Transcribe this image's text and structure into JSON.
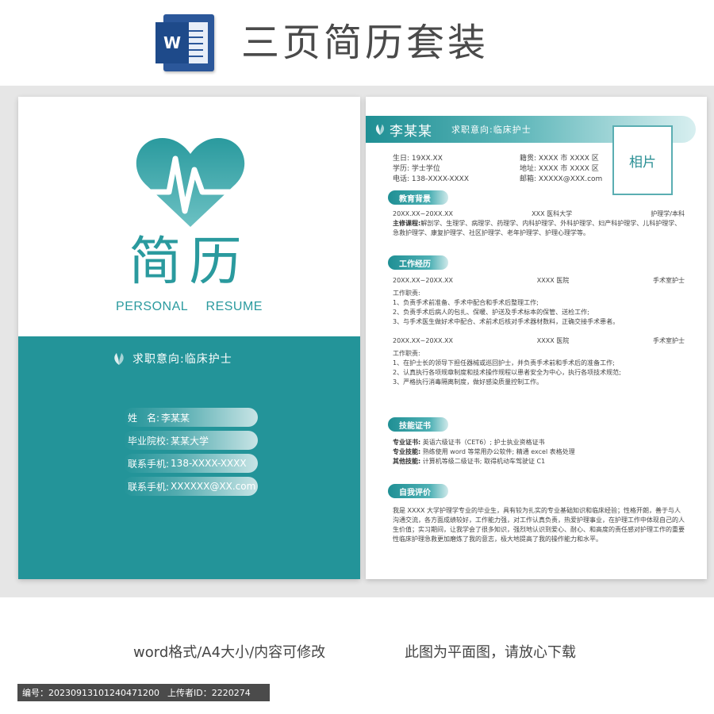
{
  "header": {
    "app_icon": "word-icon",
    "app_icon_letter": "W",
    "title": "三页简历套装"
  },
  "colors": {
    "accent": "#239499",
    "accent_light": "#5db6b9",
    "header_text": "#4a4a4a",
    "word_blue": "#2b579a"
  },
  "cover": {
    "logo": "heart-ecg-icon",
    "title": "简历",
    "subtitle": "PERSONAL RESUME",
    "intent_icon": "leaf-icon",
    "intent": "求职意向:临床护士",
    "info": [
      {
        "label": "姓　名:",
        "value": "李某某"
      },
      {
        "label": "毕业院校:",
        "value": "某某大学"
      },
      {
        "label": "联系手机:",
        "value": "138-XXXX-XXXX"
      },
      {
        "label": "联系手机:",
        "value": "XXXXXX@XX.com"
      }
    ]
  },
  "resume": {
    "name": "李某某",
    "intent": "求职意向:临床护士",
    "photo_label": "相片",
    "basic": [
      {
        "left": "生日: 19XX.XX",
        "right": "籍贯: XXXX 市 XXXX 区"
      },
      {
        "left": "学历: 学士学位",
        "right": "地址: XXXX 市 XXXX 区"
      },
      {
        "left": "电话: 138-XXXX-XXXX",
        "right": "邮箱: XXXXX@XXX.com"
      }
    ],
    "education": {
      "title": "教育背景",
      "period": "20XX.XX~20XX.XX",
      "school": "XXX 医科大学",
      "degree": "护理学/本科",
      "courses_label": "主修课程:",
      "courses": "解剖学、生理学、病理学、药理学、内科护理学、外科护理学、妇产科护理学、儿科护理学、急救护理学、康复护理学、社区护理学、老年护理学、护理心理学等。"
    },
    "work": {
      "title": "工作经历",
      "jobs": [
        {
          "period": "20XX.XX~20XX.XX",
          "org": "XXXX 医院",
          "role": "手术室护士",
          "duties_label": "工作职责:",
          "duties": [
            "1、负责手术前准备、手术中配合和手术后整理工作;",
            "2、负责手术后病人的包扎、保暖、护送及手术标本的保管、送检工作;",
            "3、与手术医生做好术中配合、术前术后核对手术器材数料，正确交接手术患者。"
          ]
        },
        {
          "period": "20XX.XX~20XX.XX",
          "org": "XXXX 医院",
          "role": "手术室护士",
          "duties_label": "工作职责:",
          "duties": [
            "1、在护士长的领导下担任器械或巡回护士，并负责手术前和手术后的准备工作;",
            "2、认真执行各项规章制度和技术操作规程以患者安全为中心，执行各项技术规范;",
            "3、严格执行消毒隔离制度，做好感染质量控制工作。"
          ]
        }
      ]
    },
    "skills": {
      "title": "技能证书",
      "items": [
        {
          "label": "专业证书:",
          "value": "英语六级证书（CET6）; 护士执业资格证书"
        },
        {
          "label": "专业技能:",
          "value": "熟练使用 word 等常用办公软件; 精通 excel 表格处理"
        },
        {
          "label": "其他技能:",
          "value": "计算机等级二级证书; 取得机动车驾驶证 C1"
        }
      ]
    },
    "self_eval": {
      "title": "自我评价",
      "text": "我是 XXXX 大学护理学专业的毕业生，具有较为扎实的专业基础知识和临床经验；性格开朗，善于与人沟通交流，各方面成绩较好，工作能力强，对工作认真负责，热爱护理事业，在护理工作中体现自己的人生价值；实习期间，让我学会了很多知识，强烈地认识到爱心、耐心、和高度的责任感对护理工作的重要性临床护理急救更加磨炼了我的意志，极大地提高了我的操作能力和水平。"
    }
  },
  "footer": {
    "left": "word格式/A4大小/内容可修改",
    "right": "此图为平面图，请放心下载",
    "id_label": "编号：",
    "id_value": "20230913101240471200",
    "uploader_label": "上传者ID：",
    "uploader_value": "2220274"
  }
}
